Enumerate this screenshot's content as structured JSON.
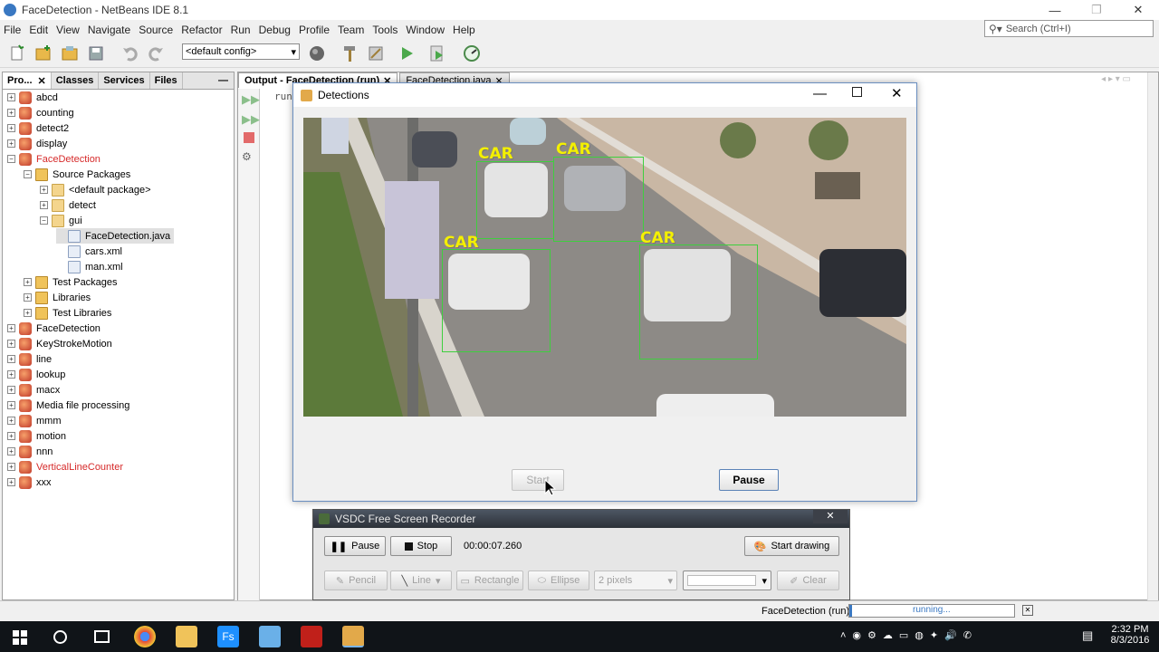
{
  "window": {
    "title": "FaceDetection - NetBeans IDE 8.1",
    "minimize": "—",
    "restore": "❐",
    "close": "✕"
  },
  "menu": [
    "File",
    "Edit",
    "View",
    "Navigate",
    "Source",
    "Refactor",
    "Run",
    "Debug",
    "Profile",
    "Team",
    "Tools",
    "Window",
    "Help"
  ],
  "search": {
    "placeholder": "Search (Ctrl+I)"
  },
  "toolbar": {
    "config": "<default config>"
  },
  "left_tabs": [
    "Pro...",
    "Classes",
    "Services",
    "Files"
  ],
  "tree": [
    {
      "label": "abcd",
      "icon": "project-icon",
      "exp": "+",
      "red": false
    },
    {
      "label": "counting",
      "icon": "project-icon",
      "exp": "+",
      "red": false
    },
    {
      "label": "detect2",
      "icon": "project-icon",
      "exp": "+",
      "red": false
    },
    {
      "label": "display",
      "icon": "project-icon",
      "exp": "+",
      "red": false
    },
    {
      "label": "FaceDetection",
      "icon": "project-icon",
      "exp": "−",
      "red": true
    },
    {
      "label": "Source Packages",
      "icon": "folder-icon",
      "exp": "−",
      "red": false
    },
    {
      "label": "<default package>",
      "icon": "package-icon",
      "exp": "+",
      "red": false
    },
    {
      "label": "detect",
      "icon": "package-icon",
      "exp": "+",
      "red": false
    },
    {
      "label": "gui",
      "icon": "package-icon",
      "exp": "−",
      "red": false
    },
    {
      "label": "FaceDetection.java",
      "icon": "java-file-icon",
      "exp": "",
      "red": false
    },
    {
      "label": "cars.xml",
      "icon": "xml-file-icon",
      "exp": "",
      "red": false
    },
    {
      "label": "man.xml",
      "icon": "xml-file-icon",
      "exp": "",
      "red": false
    },
    {
      "label": "Test Packages",
      "icon": "folder-icon",
      "exp": "+",
      "red": false
    },
    {
      "label": "Libraries",
      "icon": "folder-icon",
      "exp": "+",
      "red": false
    },
    {
      "label": "Test Libraries",
      "icon": "folder-icon",
      "exp": "+",
      "red": false
    },
    {
      "label": "FaceDetection",
      "icon": "project-icon",
      "exp": "+",
      "red": false
    },
    {
      "label": "KeyStrokeMotion",
      "icon": "project-icon",
      "exp": "+",
      "red": false
    },
    {
      "label": "line",
      "icon": "project-icon",
      "exp": "+",
      "red": false
    },
    {
      "label": "lookup",
      "icon": "project-icon",
      "exp": "+",
      "red": false
    },
    {
      "label": "macx",
      "icon": "project-icon",
      "exp": "+",
      "red": false
    },
    {
      "label": "Media file processing",
      "icon": "project-icon",
      "exp": "+",
      "red": false
    },
    {
      "label": "mmm",
      "icon": "project-icon",
      "exp": "+",
      "red": false
    },
    {
      "label": "motion",
      "icon": "project-icon",
      "exp": "+",
      "red": false
    },
    {
      "label": "nnn",
      "icon": "project-icon",
      "exp": "+",
      "red": false
    },
    {
      "label": "VerticalLineCounter",
      "icon": "project-icon",
      "exp": "+",
      "red": true
    },
    {
      "label": "xxx",
      "icon": "project-icon",
      "exp": "+",
      "red": false
    }
  ],
  "output_tabs": [
    "Output - FaceDetection (run)",
    "FaceDetection.java"
  ],
  "output_text": "run:",
  "detections": {
    "title": "Detections",
    "labels": [
      "CAR",
      "CAR",
      "CAR",
      "CAR"
    ],
    "start_label": "Start",
    "pause_label": "Pause"
  },
  "recorder": {
    "title": "VSDC Free Screen Recorder",
    "pause": "Pause",
    "stop": "Stop",
    "time": "00:00:07.260",
    "start_drawing": "Start drawing",
    "pencil": "Pencil",
    "line": "Line",
    "rectangle": "Rectangle",
    "ellipse": "Ellipse",
    "pixels": "2 pixels",
    "clear": "Clear"
  },
  "status": {
    "run_label": "FaceDetection (run)",
    "progress_text": "running..."
  },
  "tray": {
    "time": "2:32 PM",
    "date": "8/3/2016"
  }
}
